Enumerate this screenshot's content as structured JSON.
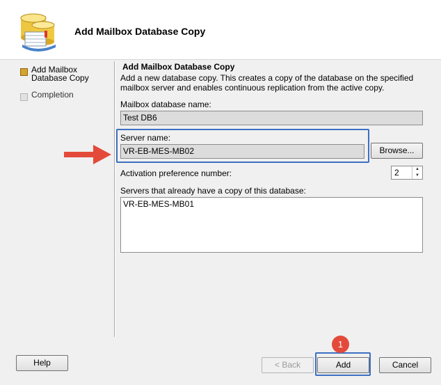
{
  "window": {
    "title": "Add Mailbox Database Copy"
  },
  "nav": {
    "items": [
      {
        "label": "Add Mailbox\nDatabase Copy",
        "state": "active"
      },
      {
        "label": "Completion",
        "state": "inactive"
      }
    ]
  },
  "page": {
    "section_title": "Add Mailbox Database Copy",
    "description": "Add a new database copy. This creates a copy of the database on the specified mailbox server and enables continuous replication from the active copy.",
    "db_name_label": "Mailbox database name:",
    "db_name_value": "Test DB6",
    "server_label": "Server name:",
    "server_value": "VR-EB-MES-MB02",
    "browse_label": "Browse...",
    "activation_label": "Activation preference number:",
    "activation_value": "2",
    "servers_list_label": "Servers that already have a copy of this database:",
    "servers_list": [
      "VR-EB-MES-MB01"
    ]
  },
  "footer": {
    "help_label": "Help",
    "back_label": "< Back",
    "add_label": "Add",
    "cancel_label": "Cancel"
  },
  "annotations": {
    "step_badge": "1"
  },
  "colors": {
    "highlight": "#3d6fc2",
    "arrow": "#e34a3a",
    "badge": "#e34a3a",
    "nav_active": "#d6a42a"
  }
}
